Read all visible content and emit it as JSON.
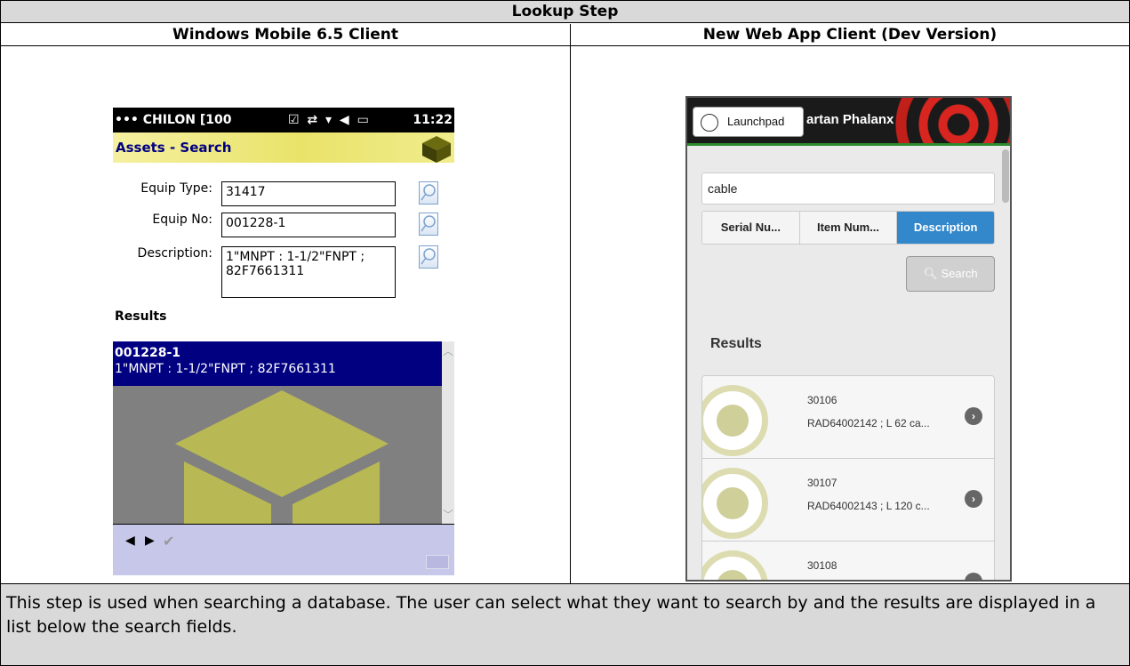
{
  "table": {
    "title": "Lookup Step",
    "left_heading": "Windows Mobile 6.5 Client",
    "right_heading": "New Web App Client (Dev Version)",
    "description": "This step is used when searching a database. The user can select what they want to search by and the results are displayed in a list below the search fields."
  },
  "wm": {
    "status_text": "••• CHILON [100",
    "status_icons": "☑ ⇄ ▾ ◀ ▭",
    "clock": "11:22",
    "title": "Assets - Search",
    "fields": [
      {
        "label": "Equip Type:",
        "value": "31417"
      },
      {
        "label": "Equip No:",
        "value": "001228-1"
      },
      {
        "label": "Description:",
        "value": "1\"MNPT : 1-1/2\"FNPT ; 82F7661311"
      }
    ],
    "results_label": "Results",
    "selected_item": {
      "number": "001228-1",
      "description": "1\"MNPT : 1-1/2\"FNPT ; 82F7661311"
    }
  },
  "web": {
    "launchpad_label": "Launchpad",
    "app_title": "artan Phalanx",
    "search_value": "cable",
    "segments": [
      "Serial Nu...",
      "Item Num...",
      "Description"
    ],
    "selected_segment": "Description",
    "search_button": "Search",
    "results_label": "Results",
    "items": [
      {
        "number": "30106",
        "description": "RAD64002142 ; L 62 ca..."
      },
      {
        "number": "30107",
        "description": "RAD64002143 ; L 120 c..."
      },
      {
        "number": "30108",
        "description": ""
      }
    ],
    "colors": {
      "accent": "#3388cc",
      "header_red": "#d8251f",
      "header_rule": "#2e8b2e"
    }
  }
}
